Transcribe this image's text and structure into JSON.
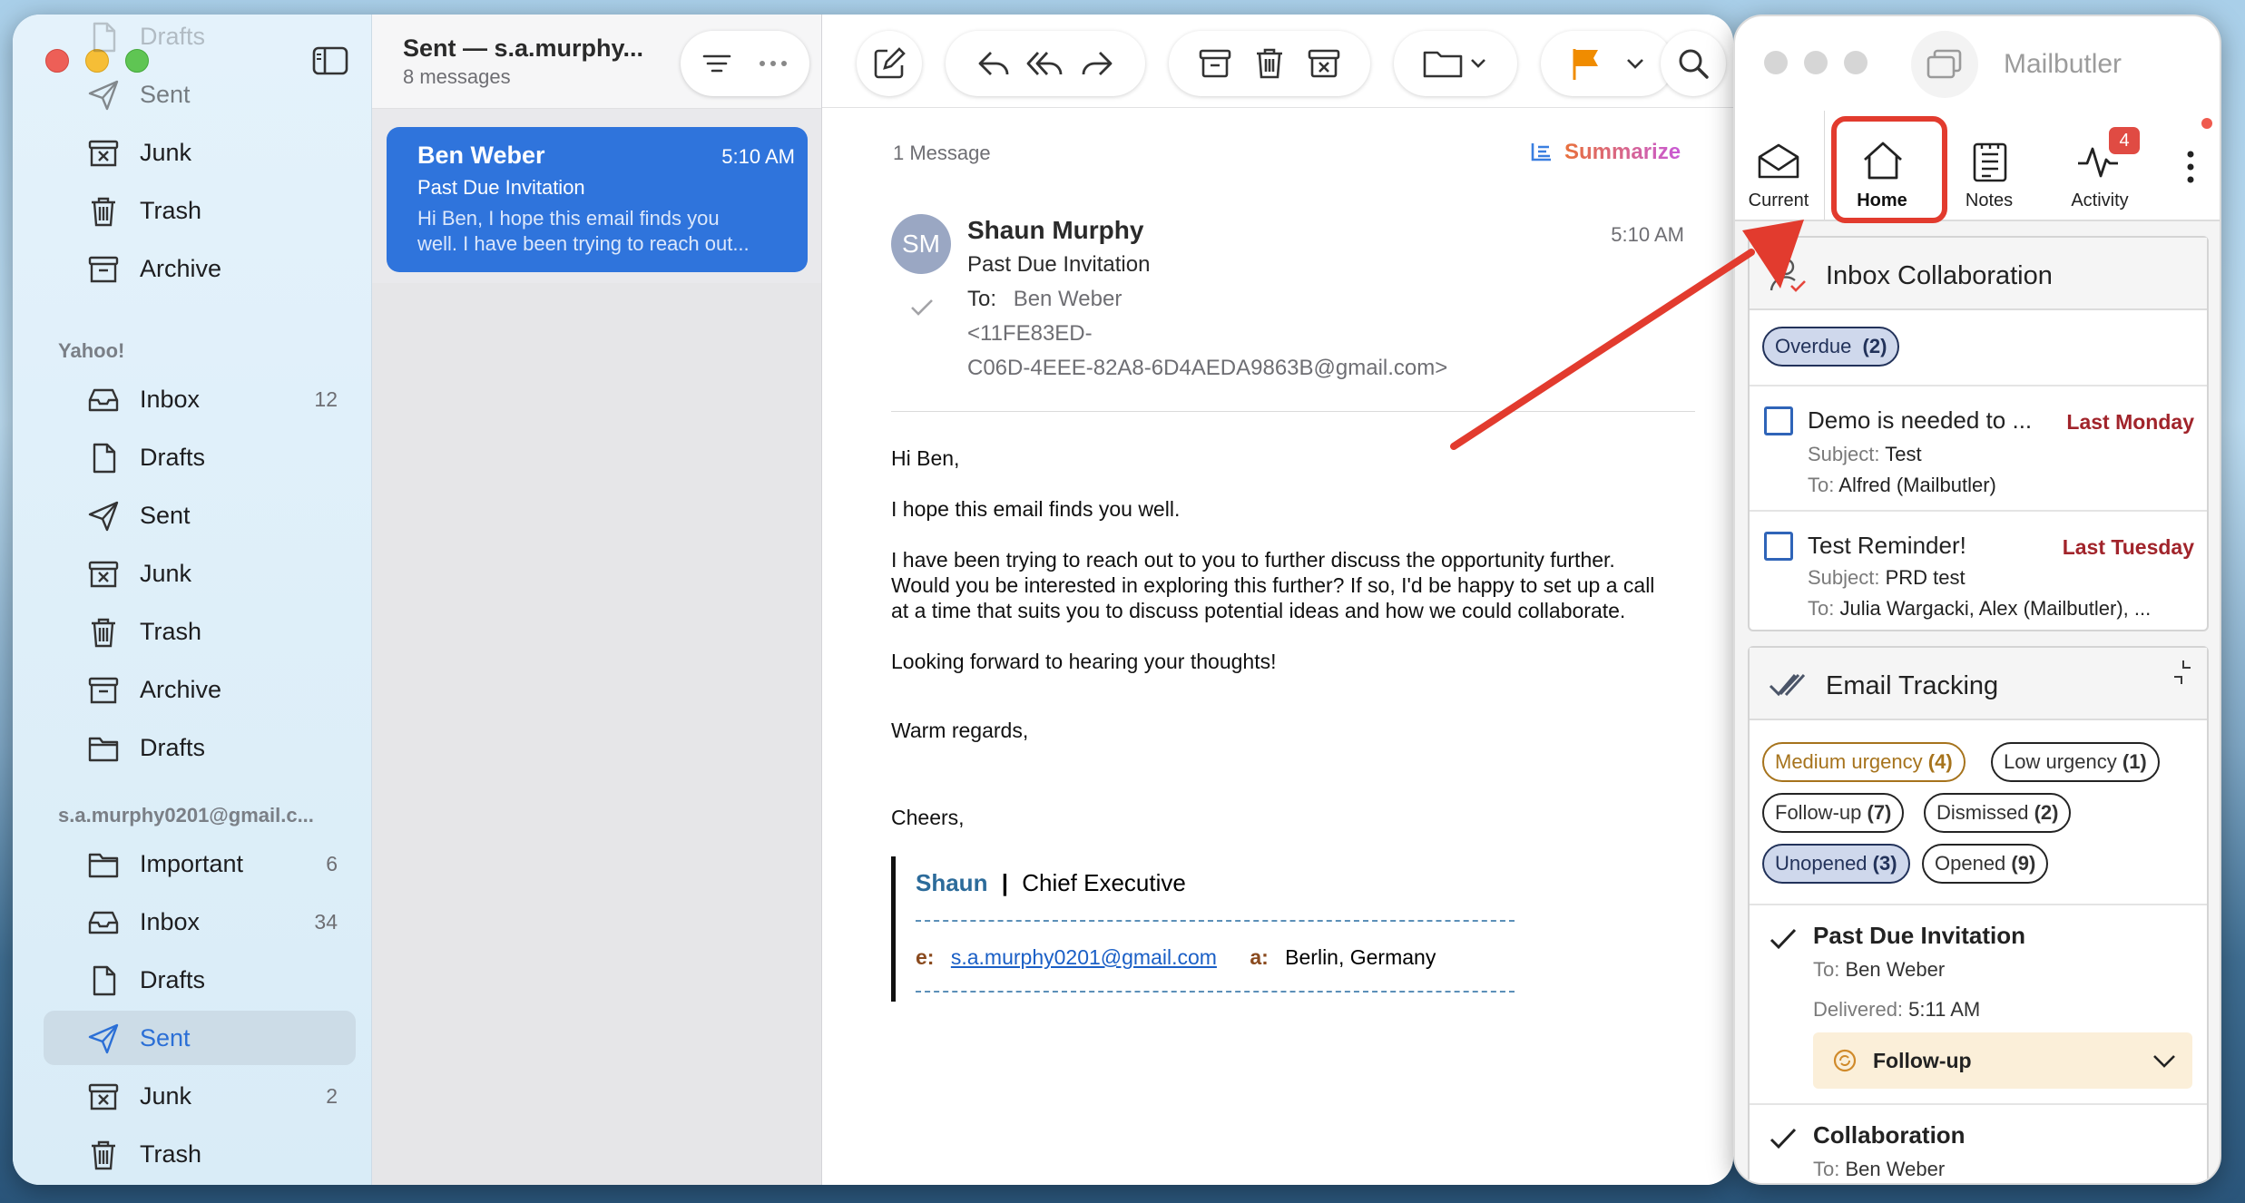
{
  "sidebar": {
    "items": [
      {
        "label": "Drafts",
        "icon": "draft-icon",
        "count": ""
      },
      {
        "label": "Sent",
        "icon": "sent-icon",
        "count": ""
      },
      {
        "label": "Junk",
        "icon": "junk-icon",
        "count": ""
      },
      {
        "label": "Trash",
        "icon": "trash-icon",
        "count": ""
      },
      {
        "label": "Archive",
        "icon": "archive-icon",
        "count": ""
      }
    ],
    "yahoo": {
      "title": "Yahoo!",
      "items": [
        {
          "label": "Inbox",
          "icon": "inbox-icon",
          "count": "12"
        },
        {
          "label": "Drafts",
          "icon": "draft-icon",
          "count": ""
        },
        {
          "label": "Sent",
          "icon": "sent-icon",
          "count": ""
        },
        {
          "label": "Junk",
          "icon": "junk-icon",
          "count": ""
        },
        {
          "label": "Trash",
          "icon": "trash-icon",
          "count": ""
        },
        {
          "label": "Archive",
          "icon": "archive-icon",
          "count": ""
        },
        {
          "label": "Drafts",
          "icon": "folder-icon",
          "count": ""
        }
      ]
    },
    "gmail": {
      "title": "s.a.murphy0201@gmail.c...",
      "items": [
        {
          "label": "Important",
          "icon": "folder-icon",
          "count": "6"
        },
        {
          "label": "Inbox",
          "icon": "inbox-icon",
          "count": "34"
        },
        {
          "label": "Drafts",
          "icon": "draft-icon",
          "count": ""
        },
        {
          "label": "Sent",
          "icon": "sent-icon",
          "count": "",
          "selected": true
        },
        {
          "label": "Junk",
          "icon": "junk-icon",
          "count": "2"
        },
        {
          "label": "Trash",
          "icon": "trash-icon",
          "count": ""
        }
      ]
    }
  },
  "mailbox": {
    "title": "Sent — s.a.murphy...",
    "count": "8 messages"
  },
  "message_list": [
    {
      "sender": "Ben Weber",
      "time": "5:10 AM",
      "subject": "Past Due Invitation",
      "preview1": "Hi Ben, I hope this email finds you",
      "preview2": "well. I have been trying to reach out..."
    }
  ],
  "reader": {
    "count_label": "1 Message",
    "summarize": "Summarize",
    "avatar": "SM",
    "from": "Shaun Murphy",
    "time": "5:10 AM",
    "subject": "Past Due Invitation",
    "to_label": "To:",
    "to": "Ben Weber",
    "to_addr1": "<11FE83ED-",
    "to_addr2": "C06D-4EEE-82A8-6D4AEDA9863B@gmail.com>",
    "body": [
      "Hi Ben,",
      "I hope this email finds you well.",
      "I have been trying to reach out to you to further discuss the opportunity further.",
      "Would you be interested in exploring this further? If so, I'd be happy to set up a call",
      "at a time that suits you to discuss potential ideas and how we could collaborate.",
      "Looking forward to hearing your thoughts!",
      "Warm regards,",
      "Cheers,"
    ],
    "sig": {
      "name": "Shaun",
      "title": "Chief Executive",
      "e_label": "e:",
      "email": "s.a.murphy0201@gmail.com",
      "a_label": "a:",
      "address": "Berlin, Germany"
    }
  },
  "mailbutler": {
    "title": "Mailbutler",
    "badge": "4",
    "tabs": [
      {
        "label": "Current",
        "icon": "envelope-open-icon"
      },
      {
        "label": "Home",
        "icon": "home-icon",
        "active": true
      },
      {
        "label": "Notes",
        "icon": "notes-icon"
      },
      {
        "label": "Activity",
        "icon": "activity-icon"
      }
    ],
    "collab": {
      "title": "Inbox Collaboration",
      "filter": "Overdue",
      "filter_count": "(2)",
      "tasks": [
        {
          "title": "Demo is needed to ...",
          "due": "Last Monday",
          "subject_label": "Subject:",
          "subject": "Test",
          "to_label": "To:",
          "to": "Alfred (Mailbutler)"
        },
        {
          "title": "Test Reminder!",
          "due": "Last Tuesday",
          "subject_label": "Subject:",
          "subject": "PRD test",
          "to_label": "To:",
          "to": "Julia Wargacki, Alex (Mailbutler), ..."
        }
      ]
    },
    "tracking": {
      "title": "Email Tracking",
      "pills": [
        {
          "label": "Medium urgency",
          "count": "(4)"
        },
        {
          "label": "Low urgency",
          "count": "(1)"
        },
        {
          "label": "Follow-up",
          "count": "(7)"
        },
        {
          "label": "Dismissed",
          "count": "(2)"
        },
        {
          "label": "Unopened",
          "count": "(3)"
        },
        {
          "label": "Opened",
          "count": "(9)"
        }
      ],
      "items": [
        {
          "title": "Past Due Invitation",
          "to_label": "To:",
          "to": "Ben Weber",
          "delivered_label": "Delivered:",
          "delivered": "5:11 AM",
          "status": "Follow-up"
        },
        {
          "title": "Collaboration",
          "to_label": "To:",
          "to": "Ben Weber"
        }
      ]
    }
  },
  "colors": {
    "accent": "#2f74dc",
    "annotation": "#e23b2e",
    "overdue": "#a1242b",
    "medium": "#a6731c",
    "flag": "#f08c00"
  }
}
